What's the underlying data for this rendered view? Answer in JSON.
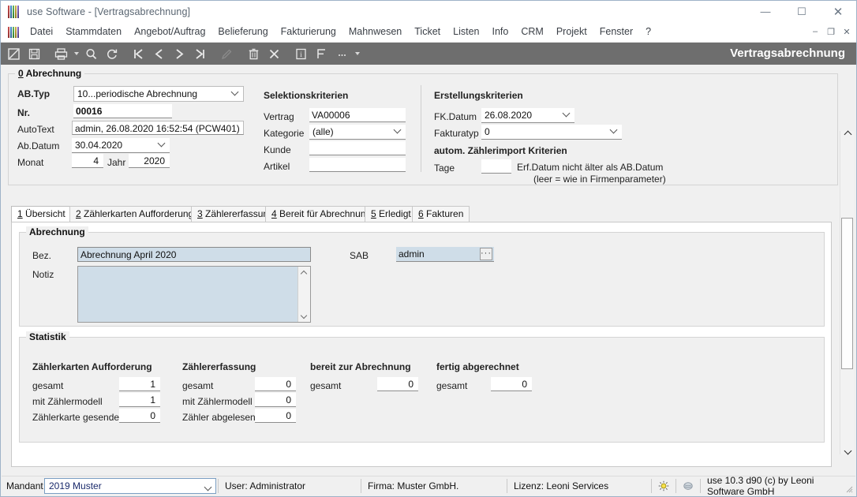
{
  "window": {
    "title": "use Software - [Vertragsabrechnung]",
    "minimize": "—",
    "maximize": "☐",
    "close": "✕",
    "mdi_minimize": "–",
    "mdi_restore": "❐",
    "mdi_close": "✕"
  },
  "menu": {
    "items": [
      "Datei",
      "Stammdaten",
      "Angebot/Auftrag",
      "Belieferung",
      "Fakturierung",
      "Mahnwesen",
      "Ticket",
      "Listen",
      "Info",
      "CRM",
      "Projekt",
      "Fenster",
      "?"
    ]
  },
  "toolbar": {
    "form_title": "Vertragsabrechnung",
    "icons": [
      "new-record-icon",
      "save-icon",
      "print-icon",
      "print-dropdown-icon",
      "search-icon",
      "refresh-icon",
      "first-record-icon",
      "previous-record-icon",
      "next-record-icon",
      "last-record-icon",
      "edit-icon",
      "delete-icon",
      "cancel-icon",
      "info-icon",
      "form-icon",
      "more-icon",
      "more-dropdown-icon"
    ]
  },
  "header_group": {
    "title_prefix": "0",
    "title": " Abrechnung",
    "ab_typ": {
      "label": "AB.Typ",
      "value": "10...periodische Abrechnung"
    },
    "nr": {
      "label": "Nr.",
      "value": "00016"
    },
    "autotext": {
      "label": "AutoText",
      "value": "admin, 26.08.2020 16:52:54 (PCW401)"
    },
    "ab_datum": {
      "label": "Ab.Datum",
      "value": "30.04.2020"
    },
    "monat": {
      "label": "Monat",
      "value": "4"
    },
    "jahr": {
      "label": "Jahr",
      "value": "2020"
    }
  },
  "selection": {
    "title": "Selektionskriterien",
    "vertrag": {
      "label": "Vertrag",
      "value": "VA00006"
    },
    "kategorie": {
      "label": "Kategorie",
      "value": "(alle)"
    },
    "kunde": {
      "label": "Kunde",
      "value": ""
    },
    "artikel": {
      "label": "Artikel",
      "value": ""
    }
  },
  "creation": {
    "title": "Erstellungskriterien",
    "fk_datum": {
      "label": "FK.Datum",
      "value": "26.08.2020"
    },
    "fakturatyp": {
      "label": "Fakturatyp",
      "value": "0"
    },
    "import_title": "autom. Zählerimport Kriterien",
    "tage": {
      "label": "Tage",
      "value": ""
    },
    "hint1": "Erf.Datum nicht älter als AB.Datum",
    "hint2": "(leer = wie in Firmenparameter)"
  },
  "tabs": [
    {
      "num": "1",
      "label": " Übersicht",
      "active": true
    },
    {
      "num": "2",
      "label": " Zählerkarten Aufforderung",
      "active": false
    },
    {
      "num": "3",
      "label": " Zählererfassung",
      "active": false
    },
    {
      "num": "4",
      "label": " Bereit für Abrechnung",
      "active": false
    },
    {
      "num": "5",
      "label": " Erledigt",
      "active": false
    },
    {
      "num": "6",
      "label": " Fakturen",
      "active": false
    }
  ],
  "abrechnung": {
    "title": "Abrechnung",
    "bez": {
      "label": "Bez.",
      "value": "Abrechnung April 2020"
    },
    "notiz": {
      "label": "Notiz",
      "value": ""
    },
    "sab": {
      "label": "SAB",
      "value": "admin",
      "button": "···"
    }
  },
  "statistik": {
    "title": "Statistik",
    "columns": [
      {
        "heading": "Zählerkarten Aufforderung",
        "rows": [
          {
            "label": "gesamt",
            "value": "1"
          },
          {
            "label": "mit Zählermodell",
            "value": "1"
          },
          {
            "label": "Zählerkarte gesendet",
            "value": "0"
          }
        ]
      },
      {
        "heading": "Zählererfassung",
        "rows": [
          {
            "label": "gesamt",
            "value": "0"
          },
          {
            "label": "mit Zählermodell",
            "value": "0"
          },
          {
            "label": "Zähler abgelesen",
            "value": "0"
          }
        ]
      },
      {
        "heading": "bereit zur Abrechnung",
        "rows": [
          {
            "label": "gesamt",
            "value": "0"
          }
        ]
      },
      {
        "heading": "fertig abgerechnet",
        "rows": [
          {
            "label": "gesamt",
            "value": "0"
          }
        ]
      }
    ]
  },
  "statusbar": {
    "mandant_label": "Mandant",
    "mandant_value": "2019 Muster",
    "user": "User: Administrator",
    "firma": "Firma: Muster GmbH.",
    "lizenz": "Lizenz: Leoni Services",
    "version": "use 10.3 d90 (c) by Leoni Software GmbH",
    "icons": [
      "hint-bulb-icon",
      "network-icon"
    ]
  },
  "colors": {
    "toolbar_bg": "#6e6e6e",
    "field_readonly": "#cfdde8",
    "accent": "#7a9ec2"
  }
}
